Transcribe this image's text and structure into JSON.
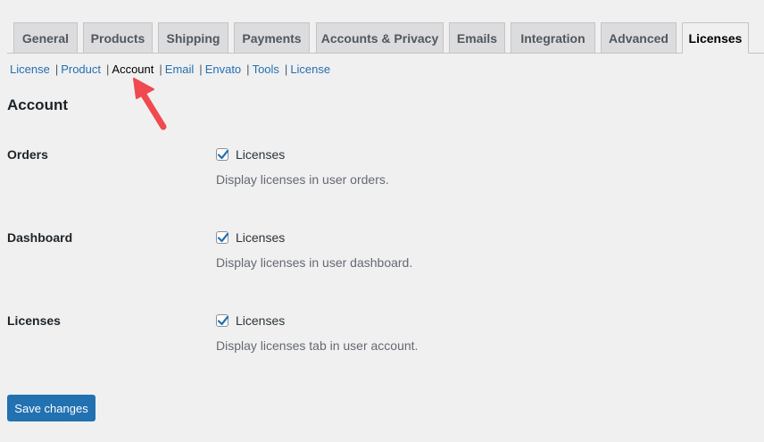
{
  "tabs": [
    {
      "label": "General",
      "active": false
    },
    {
      "label": "Products",
      "active": false
    },
    {
      "label": "Shipping",
      "active": false
    },
    {
      "label": "Payments",
      "active": false
    },
    {
      "label": "Accounts & Privacy",
      "active": false
    },
    {
      "label": "Emails",
      "active": false
    },
    {
      "label": "Integration",
      "active": false
    },
    {
      "label": "Advanced",
      "active": false
    },
    {
      "label": "Licenses",
      "active": true
    }
  ],
  "subnav": [
    {
      "label": "License",
      "current": false
    },
    {
      "label": "Product",
      "current": false
    },
    {
      "label": "Account",
      "current": true
    },
    {
      "label": "Email",
      "current": false
    },
    {
      "label": "Envato",
      "current": false
    },
    {
      "label": "Tools",
      "current": false
    },
    {
      "label": "License",
      "current": false
    }
  ],
  "section_title": "Account",
  "settings": [
    {
      "label": "Orders",
      "checkbox_label": "Licenses",
      "checked": true,
      "description": "Display licenses in user orders."
    },
    {
      "label": "Dashboard",
      "checkbox_label": "Licenses",
      "checked": true,
      "description": "Display licenses in user dashboard."
    },
    {
      "label": "Licenses",
      "checkbox_label": "Licenses",
      "checked": true,
      "description": "Display licenses tab in user account."
    }
  ],
  "save_label": "Save changes",
  "colors": {
    "accent": "#2271b1",
    "annotation_arrow": "#f0494f"
  },
  "icons": {
    "checkmark": "checkmark-icon",
    "annotation": "red-arrow-icon"
  }
}
